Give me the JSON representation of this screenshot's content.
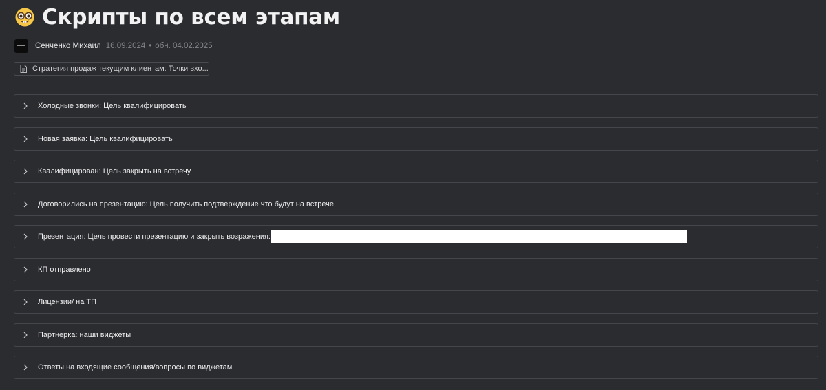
{
  "page": {
    "emoji": "nerd-face-icon",
    "title": "Скрипты по всем этапам"
  },
  "meta": {
    "author": "Сенченко Михаил",
    "created": "16.09.2024",
    "separator": "•",
    "updated": "обн. 04.02.2025"
  },
  "breadcrumb": {
    "icon": "document-icon",
    "label": "Стратегия продаж текущим клиентам: Точки вхо..."
  },
  "toggles": [
    {
      "label": "Холодные звонки: Цель квалифицировать"
    },
    {
      "label": "Новая заявка: Цель квалифицировать"
    },
    {
      "label": "Квалифицирован: Цель закрыть на встречу"
    },
    {
      "label": "Договорились на презентацию: Цель получить подтверждение что будут на встрече"
    },
    {
      "label": "Презентация: Цель провести презентацию и закрыть возражения:",
      "redacted": true
    },
    {
      "label": "КП отправлено"
    },
    {
      "label": "Лицензии/ на ТП"
    },
    {
      "label": "Партнерка: наши виджеты"
    },
    {
      "label": "Ответы на входящие сообщения/вопросы по виджетам"
    }
  ]
}
